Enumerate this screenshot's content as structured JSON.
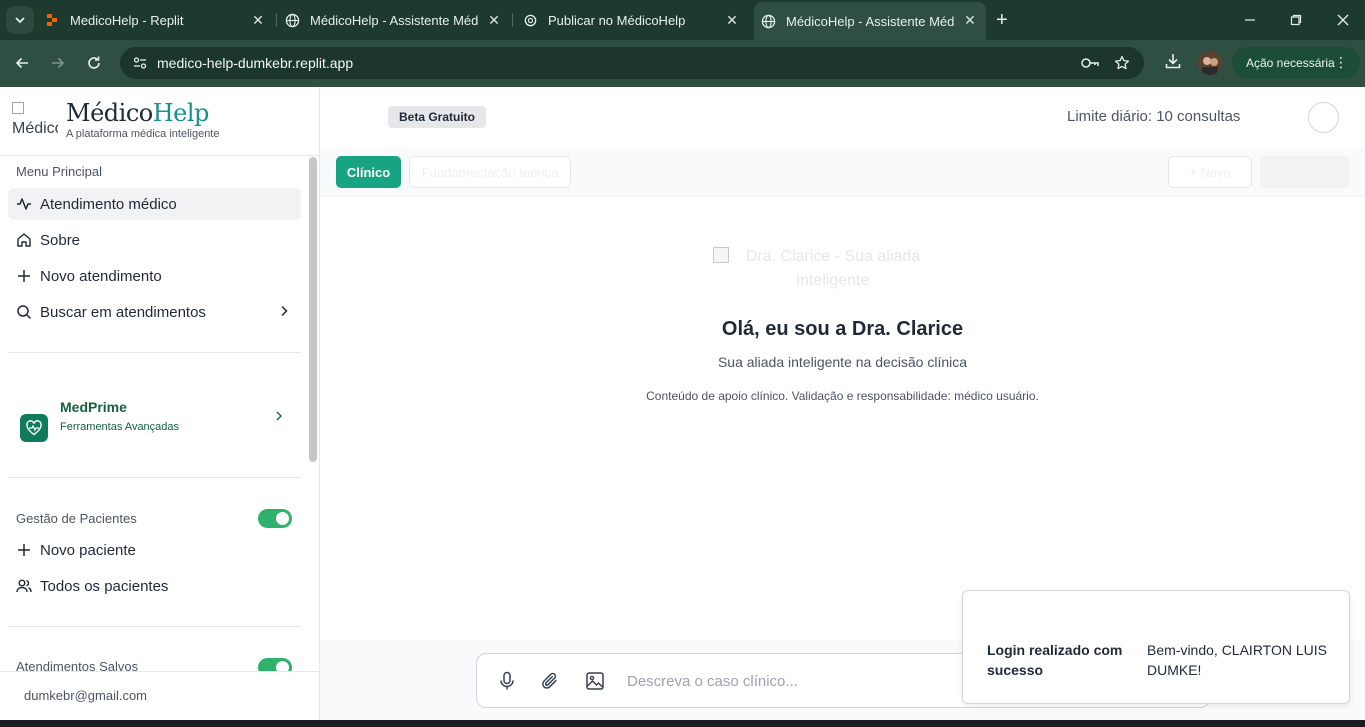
{
  "browser": {
    "tabs": [
      {
        "title": "MedicoHelp - Replit",
        "icon": "replit-icon",
        "active": false
      },
      {
        "title": "MédicoHelp - Assistente Médico",
        "icon": "globe-icon",
        "active": false
      },
      {
        "title": "Publicar no MédicoHelp",
        "icon": "openai-icon",
        "active": false
      },
      {
        "title": "MédicoHelp - Assistente Médico",
        "icon": "globe-icon",
        "active": true
      }
    ],
    "url": "medico-help-dumkebr.replit.app",
    "action_label": "Ação necessária",
    "theme_color": "#1e3a2f"
  },
  "sidebar": {
    "logo_alt": "Médico",
    "brand_first": "Médico",
    "brand_second": "Help",
    "tagline": "A plataforma médica inteligente",
    "menu_title": "Menu Principal",
    "menu_items": [
      {
        "label": "Atendimento médico",
        "icon": "activity-icon"
      },
      {
        "label": "Sobre",
        "icon": "home-icon"
      },
      {
        "label": "Novo atendimento",
        "icon": "plus-icon"
      },
      {
        "label": "Buscar em atendimentos",
        "icon": "search-icon"
      }
    ],
    "medprime": {
      "title": "MedPrime",
      "subtitle": "Ferramentas Avançadas"
    },
    "patients": {
      "title": "Gestão de Pacientes",
      "enabled": true,
      "items": [
        {
          "label": "Novo paciente",
          "icon": "plus-icon"
        },
        {
          "label": "Todos os pacientes",
          "icon": "users-icon"
        }
      ]
    },
    "saved": {
      "title": "Atendimentos Salvos",
      "enabled": true
    },
    "user_email": "dumkebr@gmail.com"
  },
  "header": {
    "badge": "Beta Gratuito",
    "limit_text": "Limite diário: 10 consultas"
  },
  "modes": {
    "primary": "Clínico",
    "secondary": "Fundamentação teórica",
    "new_label": "+ Novo"
  },
  "hero": {
    "image_alt": "Dra. Clarice - Sua aliada inteligente",
    "title": "Olá, eu sou a Dra. Clarice",
    "subtitle": "Sua aliada inteligente na decisão clínica",
    "note": "Conteúdo de apoio clínico. Validação e responsabilidade: médico usuário."
  },
  "composer": {
    "placeholder": "Descreva o caso clínico...",
    "value": ""
  },
  "toast": {
    "title": "Login realizado com sucesso",
    "message": "Bem-vindo, CLAIRTON LUIS DUMKE!"
  },
  "colors": {
    "accent": "#17a483",
    "brand_help": "#14938a",
    "toggle_on": "#2fb06b",
    "medprime": "#0f7a5c"
  }
}
